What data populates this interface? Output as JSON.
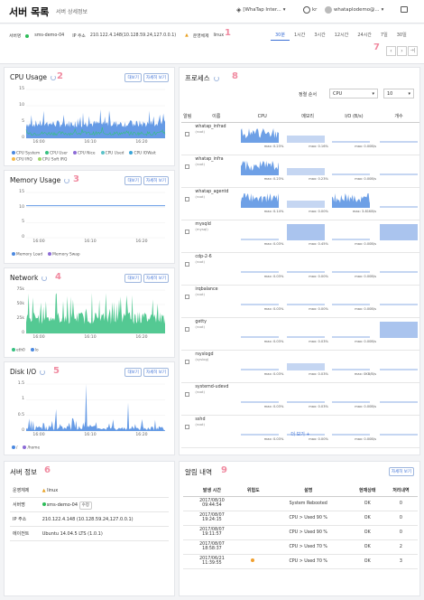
{
  "header": {
    "title": "서버 목록",
    "subtitle": "서버 상세정보",
    "project": "[WhaTap Inter...",
    "lang": "kr",
    "user": "whataplodemo@..."
  },
  "server_bar": {
    "server_label": "서버명",
    "server_name": "sms-demo-04",
    "ip_label": "IP 주소",
    "ip": "210.122.4.148(10.128.59.24,127.0.0.1)",
    "os_label": "운영체제",
    "os": "linux",
    "time_tabs": [
      "30분",
      "1시간",
      "3시간",
      "12시간",
      "24시간",
      "7일",
      "30일"
    ],
    "active_tab": "30분"
  },
  "badges": [
    "1",
    "2",
    "3",
    "4",
    "5",
    "6",
    "7",
    "8",
    "9"
  ],
  "buttons": {
    "detail": "대보기",
    "more": "자세히 보기",
    "more_link": "더 보기 +"
  },
  "cpu": {
    "title": "CPU Usage",
    "yticks": [
      "15",
      "10",
      "5",
      "0"
    ],
    "xticks": [
      "16:00",
      "16:10",
      "16:20"
    ],
    "legend": [
      {
        "label": "CPU System",
        "color": "#4a88e0"
      },
      {
        "label": "CPU User",
        "color": "#36c080"
      },
      {
        "label": "CPU Nice",
        "color": "#8c6bd6"
      },
      {
        "label": "CPU Used",
        "color": "#5bc2c8"
      },
      {
        "label": "CPU IOWait",
        "color": "#3aa5d8"
      },
      {
        "label": "CPU IRQ",
        "color": "#f4b94a"
      },
      {
        "label": "CPU Soft IRQ",
        "color": "#9fd66b"
      }
    ]
  },
  "memory": {
    "title": "Memory Usage",
    "yticks": [
      "15",
      "10",
      "5",
      "0"
    ],
    "xticks": [
      "16:00",
      "16:10",
      "16:20"
    ],
    "legend": [
      {
        "label": "Memory Load",
        "color": "#4a88e0"
      },
      {
        "label": "Memory Swap",
        "color": "#8c6bd6"
      }
    ]
  },
  "network": {
    "title": "Network",
    "yticks": [
      "75k",
      "50k",
      "25k",
      "0"
    ],
    "xticks": [
      "16:00",
      "16:10",
      "16:20"
    ],
    "legend": [
      {
        "label": "eth0",
        "color": "#36c080"
      },
      {
        "label": "lo",
        "color": "#4a88e0"
      }
    ]
  },
  "disk": {
    "title": "Disk I/O",
    "yticks": [
      "1.5",
      "1",
      "0.5",
      "0"
    ],
    "xticks": [
      "16:00",
      "16:10",
      "16:20"
    ],
    "legend": [
      {
        "label": "/",
        "color": "#4a88e0"
      },
      {
        "label": "/home",
        "color": "#8c6bd6"
      }
    ]
  },
  "process": {
    "title": "프로세스",
    "sort_label": "정렬 순서",
    "sort_value": "CPU",
    "count_value": "10",
    "columns": [
      "알림",
      "이름",
      "CPU",
      "메모리",
      "I/O (B/s)",
      "개수"
    ],
    "rows": [
      {
        "name": "whatap_infrad",
        "owner": "(root)",
        "cpu": "max: 0.23%",
        "mem": "max: 0.16%",
        "io": "max: 0.00B/s",
        "count": "1"
      },
      {
        "name": "whatap_infra",
        "owner": "(root)",
        "cpu": "max: 0.23%",
        "mem": "max: 0.23%",
        "io": "max: 0.00B/s",
        "count": "1"
      },
      {
        "name": "whatap_agentd",
        "owner": "(root)",
        "cpu": "max: 0.14%",
        "mem": "max: 0.00%",
        "io": "max: 3.81KB/s",
        "count": "1"
      },
      {
        "name": "mysqld",
        "owner": "(mysql)",
        "cpu": "max: 0.03%",
        "mem": "max: 0.45%",
        "io": "max: 0.00B/s",
        "count": "1"
      },
      {
        "name": "cdp-2-6",
        "owner": "(root)",
        "cpu": "max: 0.03%",
        "mem": "max: 0.00%",
        "io": "max: 0.00B/s",
        "count": "1"
      },
      {
        "name": "irqbalance",
        "owner": "(root)",
        "cpu": "max: 0.03%",
        "mem": "max: 0.00%",
        "io": "max: 0.00B/s",
        "count": "1"
      },
      {
        "name": "getty",
        "owner": "(root)",
        "cpu": "max: 0.03%",
        "mem": "max: 0.03%",
        "io": "max: 0.00B/s",
        "count": "6"
      },
      {
        "name": "rsyslogd",
        "owner": "(syslog)",
        "cpu": "max: 0.03%",
        "mem": "max: 0.03%",
        "io": "max: 0KB/B/s",
        "count": "1"
      },
      {
        "name": "systemd-udevd",
        "owner": "(root)",
        "cpu": "max: 0.03%",
        "mem": "max: 0.03%",
        "io": "max: 0.00B/s",
        "count": "1"
      },
      {
        "name": "sshd",
        "owner": "(root)",
        "cpu": "max: 0.03%",
        "mem": "max: 0.00%",
        "io": "max: 0.00B/s",
        "count": "1"
      }
    ]
  },
  "server_info": {
    "title": "서버 정보",
    "os_label": "운영체제",
    "os_value": "linux",
    "name_label": "서버명",
    "name_value": "sms-demo-04",
    "edit_label": "수정",
    "ip_label": "IP 주소",
    "ip_value": "210.122.4.148 (10.128.59.24,127.0.0.1)",
    "agent_label": "에이전트",
    "agent_value": "Ubuntu 14.04.5 LTS (1.0.1)"
  },
  "alarm": {
    "title": "알림 내역",
    "columns": [
      "발생 시간",
      "위험도",
      "설명",
      "현재상태",
      "처리내역"
    ],
    "rows": [
      {
        "date": "2017/08/10",
        "time": "09:44:54",
        "level": "",
        "desc": "System Rebooted",
        "state": "OK",
        "done": "0"
      },
      {
        "date": "2017/08/07",
        "time": "19:24:15",
        "level": "",
        "desc": "CPU > Used 90 %",
        "state": "OK",
        "done": "0"
      },
      {
        "date": "2017/08/07",
        "time": "19:11:57",
        "level": "",
        "desc": "CPU > Used 90 %",
        "state": "OK",
        "done": "0"
      },
      {
        "date": "2017/08/07",
        "time": "18:58:37",
        "level": "",
        "desc": "CPU > Used 70 %",
        "state": "OK",
        "done": "2"
      },
      {
        "date": "2017/06/21",
        "time": "11:39:55",
        "level": "warning",
        "desc": "CPU > Used 70 %",
        "state": "OK",
        "done": "3"
      }
    ]
  }
}
